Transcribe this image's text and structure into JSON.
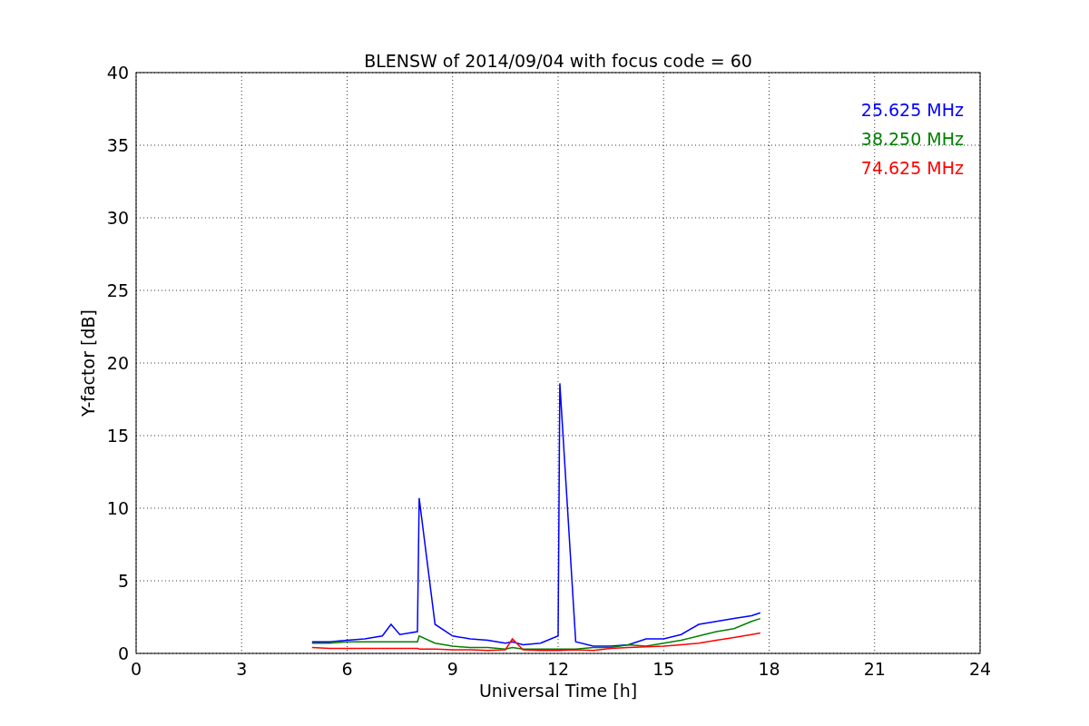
{
  "chart": {
    "chart_data": {
      "type": "line",
      "title": "BLENSW of 2014/09/04 with focus code = 60",
      "xlabel": "Universal Time [h]",
      "ylabel": "Y-factor [dB]",
      "x": [
        5,
        5.5,
        6,
        6.5,
        7,
        7.25,
        7.5,
        8,
        8.05,
        8.5,
        9,
        9.5,
        10,
        10.5,
        10.7,
        11,
        11.5,
        12,
        12.05,
        12.5,
        13,
        13.5,
        14,
        14.5,
        15,
        15.5,
        16,
        16.5,
        17,
        17.5,
        17.75
      ],
      "series": [
        {
          "name": "25.625 MHz",
          "color": "#0000ff",
          "values": [
            0.8,
            0.8,
            0.9,
            1.0,
            1.2,
            2.0,
            1.3,
            1.5,
            10.7,
            2.0,
            1.2,
            1.0,
            0.9,
            0.7,
            0.8,
            0.6,
            0.7,
            1.2,
            18.6,
            0.8,
            0.5,
            0.5,
            0.6,
            1.0,
            1.0,
            1.3,
            2.0,
            2.2,
            2.4,
            2.6,
            2.8
          ]
        },
        {
          "name": "38.250 MHz",
          "color": "#008000",
          "values": [
            0.7,
            0.7,
            0.8,
            0.8,
            0.8,
            0.8,
            0.8,
            0.8,
            1.2,
            0.7,
            0.5,
            0.4,
            0.4,
            0.3,
            0.4,
            0.3,
            0.3,
            0.3,
            0.3,
            0.3,
            0.4,
            0.4,
            0.6,
            0.5,
            0.7,
            0.9,
            1.2,
            1.5,
            1.7,
            2.2,
            2.4
          ]
        },
        {
          "name": "74.625 MHz",
          "color": "#ff0000",
          "values": [
            0.4,
            0.35,
            0.35,
            0.35,
            0.35,
            0.35,
            0.35,
            0.35,
            0.3,
            0.3,
            0.25,
            0.25,
            0.2,
            0.25,
            1.0,
            0.25,
            0.2,
            0.2,
            0.2,
            0.25,
            0.2,
            0.35,
            0.4,
            0.45,
            0.5,
            0.6,
            0.7,
            0.9,
            1.1,
            1.3,
            1.4
          ]
        }
      ],
      "grid": true,
      "xlim": [
        0,
        24
      ],
      "ylim": [
        0,
        40
      ],
      "xticks": [
        0,
        3,
        6,
        9,
        12,
        15,
        18,
        21,
        24
      ],
      "yticks": [
        0,
        5,
        10,
        15,
        20,
        25,
        30,
        35,
        40
      ]
    }
  }
}
